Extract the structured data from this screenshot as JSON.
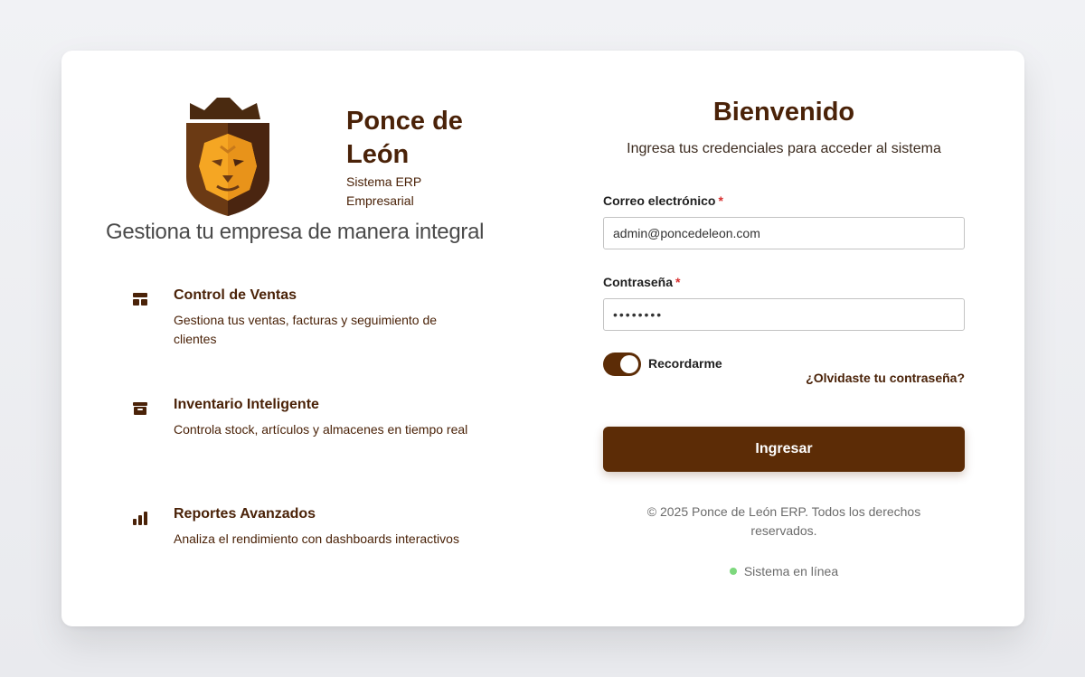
{
  "brand": {
    "name": "Ponce de León",
    "subtitle": "Sistema ERP Empresarial",
    "tagline": "Gestiona tu empresa de manera integral",
    "logo_icon": "lion-shield-crown-logo"
  },
  "features": [
    {
      "icon": "layout-icon",
      "title": "Control de Ventas",
      "description": "Gestiona tus ventas, facturas y seguimiento de clientes"
    },
    {
      "icon": "archive-box-icon",
      "title": "Inventario Inteligente",
      "description": "Controla stock, artículos y almacenes en tiempo real"
    },
    {
      "icon": "bar-chart-icon",
      "title": "Reportes Avanzados",
      "description": "Analiza el rendimiento con dashboards interactivos"
    }
  ],
  "login": {
    "title": "Bienvenido",
    "subtitle": "Ingresa tus credenciales para acceder al sistema",
    "email_label": "Correo electrónico",
    "email_value": "admin@poncedeleon.com",
    "password_label": "Contraseña",
    "password_value": "********",
    "required_mark": "*",
    "remember_label": "Recordarme",
    "remember_checked": true,
    "forgot_link": "¿Olvidaste tu contraseña?",
    "submit_label": "Ingresar"
  },
  "footer": {
    "copyright": "© 2025 Ponce de León ERP. Todos los derechos reservados.",
    "status": "Sistema en línea"
  },
  "colors": {
    "brand_brown": "#5c2c06",
    "title_brown": "#4a2208",
    "lion_orange": "#f5a623",
    "status_green": "#7dd87d"
  }
}
